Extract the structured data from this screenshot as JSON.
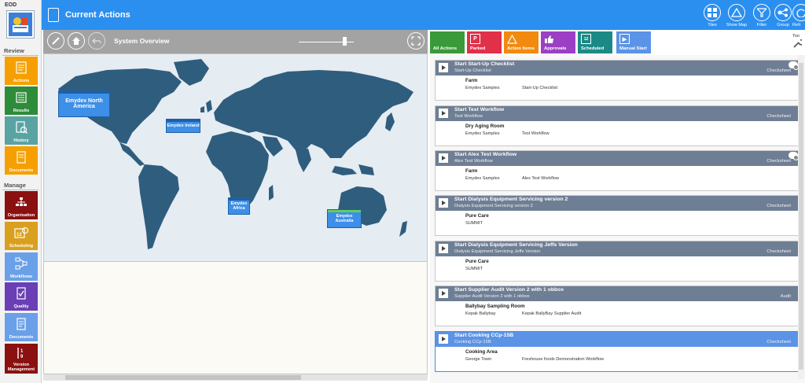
{
  "sidebar": {
    "header": "EOD",
    "review_label": "Review",
    "manage_label": "Manage",
    "review_items": [
      {
        "label": "Actions",
        "color": "#f5a000",
        "icon": "actions-icon"
      },
      {
        "label": "Results",
        "color": "#2e8b3a",
        "icon": "results-icon"
      },
      {
        "label": "History",
        "color": "#5aa3a3",
        "icon": "history-icon"
      },
      {
        "label": "Documents",
        "color": "#f5a000",
        "icon": "documents-icon"
      }
    ],
    "manage_items": [
      {
        "label": "Organisation",
        "color": "#8b1010",
        "icon": "organisation-icon"
      },
      {
        "label": "Scheduling",
        "color": "#d9a020",
        "icon": "scheduling-icon"
      },
      {
        "label": "Workflows",
        "color": "#6aa0e8",
        "icon": "workflows-icon"
      },
      {
        "label": "Quality",
        "color": "#6a3fb5",
        "icon": "quality-icon"
      },
      {
        "label": "Documents",
        "color": "#6aa0e8",
        "icon": "documents-icon"
      },
      {
        "label": "Version Management",
        "color": "#8b1010",
        "icon": "version-icon"
      }
    ]
  },
  "topbar": {
    "title": "Current Actions",
    "buttons": [
      {
        "label": "Tiles",
        "icon": "tiles-icon"
      },
      {
        "label": "Show Map",
        "icon": "map-icon"
      },
      {
        "label": "Filter",
        "icon": "filter-icon"
      },
      {
        "label": "Group",
        "icon": "group-icon"
      },
      {
        "label": "Refr",
        "icon": "refresh-icon"
      }
    ]
  },
  "map": {
    "title": "System Overview",
    "ocean_color": "#e5ecf2",
    "land_color": "#2f5d7e",
    "pins": [
      {
        "label": "Emydex North America"
      },
      {
        "label": "Emydex Ireland"
      },
      {
        "label": "Emydex Africa"
      },
      {
        "label": "Emydex Australia"
      }
    ]
  },
  "filters": [
    {
      "label": "All Actions",
      "color": "#3a9a3a"
    },
    {
      "label": "Parked",
      "color": "#e0304a"
    },
    {
      "label": "Action Items",
      "color": "#f28a10"
    },
    {
      "label": "Approvals",
      "color": "#9b3fc4"
    },
    {
      "label": "Scheduled",
      "color": "#1b8a86"
    },
    {
      "label": "Manual Start",
      "color": "#5b93e6"
    }
  ],
  "tools_label": "Too",
  "actions": [
    {
      "title": "Start Start-Up Checklist",
      "subtitle": "Start-Up Checklist",
      "type": "Checksheet",
      "location": "Farm",
      "site": "Emydex Samples",
      "form": "Start-Up Checklist",
      "cloud": true
    },
    {
      "title": "Start Test Workflow",
      "subtitle": "Test Workflow",
      "type": "Checksheet",
      "location": "Dry Aging Room",
      "site": "Emydex Samples",
      "form": "Test Workflow",
      "cloud": false
    },
    {
      "title": "Start Alex Test Workflow",
      "subtitle": "Alex Test Workflow",
      "type": "Checksheet",
      "location": "Farm",
      "site": "Emydex Samples",
      "form": "Alex Test Workflow",
      "cloud": true
    },
    {
      "title": "Start Dialysis Equipment Servicing version 2",
      "subtitle": "Dialysis Equipment Servicing version 2",
      "type": "Checksheet",
      "location": "Pure Care",
      "site": "SUMMIT",
      "form": "",
      "cloud": false
    },
    {
      "title": "Start Dialysis Equipment Servicing Jeffs Version",
      "subtitle": "Dialysis Equipment Servicing Jeffs Version",
      "type": "Checksheet",
      "location": "Pure Care",
      "site": "SUMMIT",
      "form": "",
      "cloud": false
    },
    {
      "title": "Start Supplier Audit Version 2 with 1 obbox",
      "subtitle": "Supplier Audit Version 2 with 1 obbox",
      "type": "Audit",
      "location": "Ballybay Sampling Room",
      "site": "Kepak Ballybay",
      "form": "Kepak BallyBay Supplier Audit",
      "cloud": false
    },
    {
      "title": "Start Cooking CCp-15B",
      "subtitle": "Cooking CCp-15B",
      "type": "Checksheet",
      "location": "Cooking Area",
      "site": "George Town",
      "form": "Freshouse foods Demonstration Workflow",
      "cloud": false
    }
  ]
}
